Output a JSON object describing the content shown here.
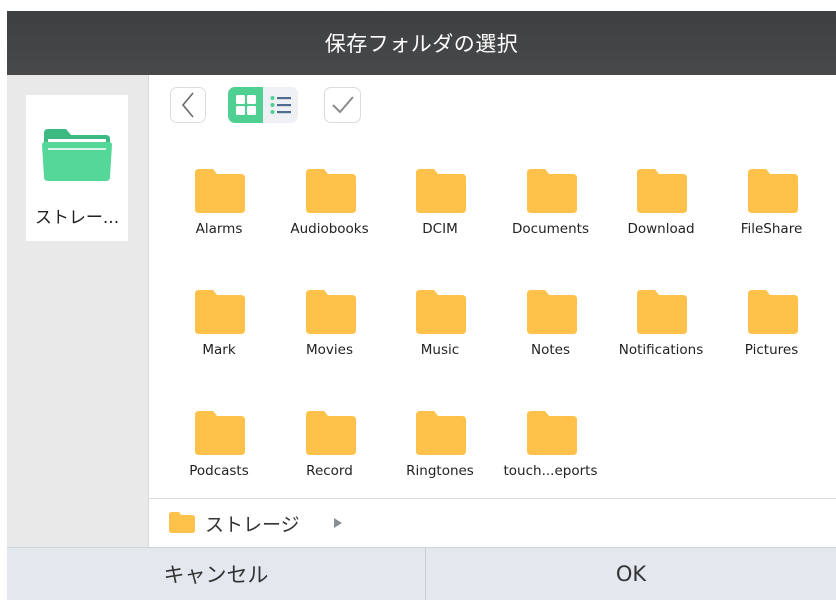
{
  "dialog": {
    "title": "保存フォルダの選択"
  },
  "sidebar": {
    "storage_label": "ストレー..."
  },
  "toolbar": {
    "back_icon": "chevron-left-icon",
    "grid_icon": "grid-view-icon",
    "list_icon": "list-view-icon",
    "select_icon": "checkmark-icon",
    "accent_color": "#4fcf92"
  },
  "folders": [
    {
      "label": "Alarms"
    },
    {
      "label": "Audiobooks"
    },
    {
      "label": "DCIM"
    },
    {
      "label": "Documents"
    },
    {
      "label": "Download"
    },
    {
      "label": "FileShare"
    },
    {
      "label": "Mark"
    },
    {
      "label": "Movies"
    },
    {
      "label": "Music"
    },
    {
      "label": "Notes"
    },
    {
      "label": "Notifications"
    },
    {
      "label": "Pictures"
    },
    {
      "label": "Podcasts"
    },
    {
      "label": "Record"
    },
    {
      "label": "Ringtones"
    },
    {
      "label": "touch...eports"
    }
  ],
  "folder_color": "#fec24a",
  "path": {
    "current": "ストレージ"
  },
  "buttons": {
    "cancel_label": "キャンセル",
    "ok_label": "OK"
  }
}
